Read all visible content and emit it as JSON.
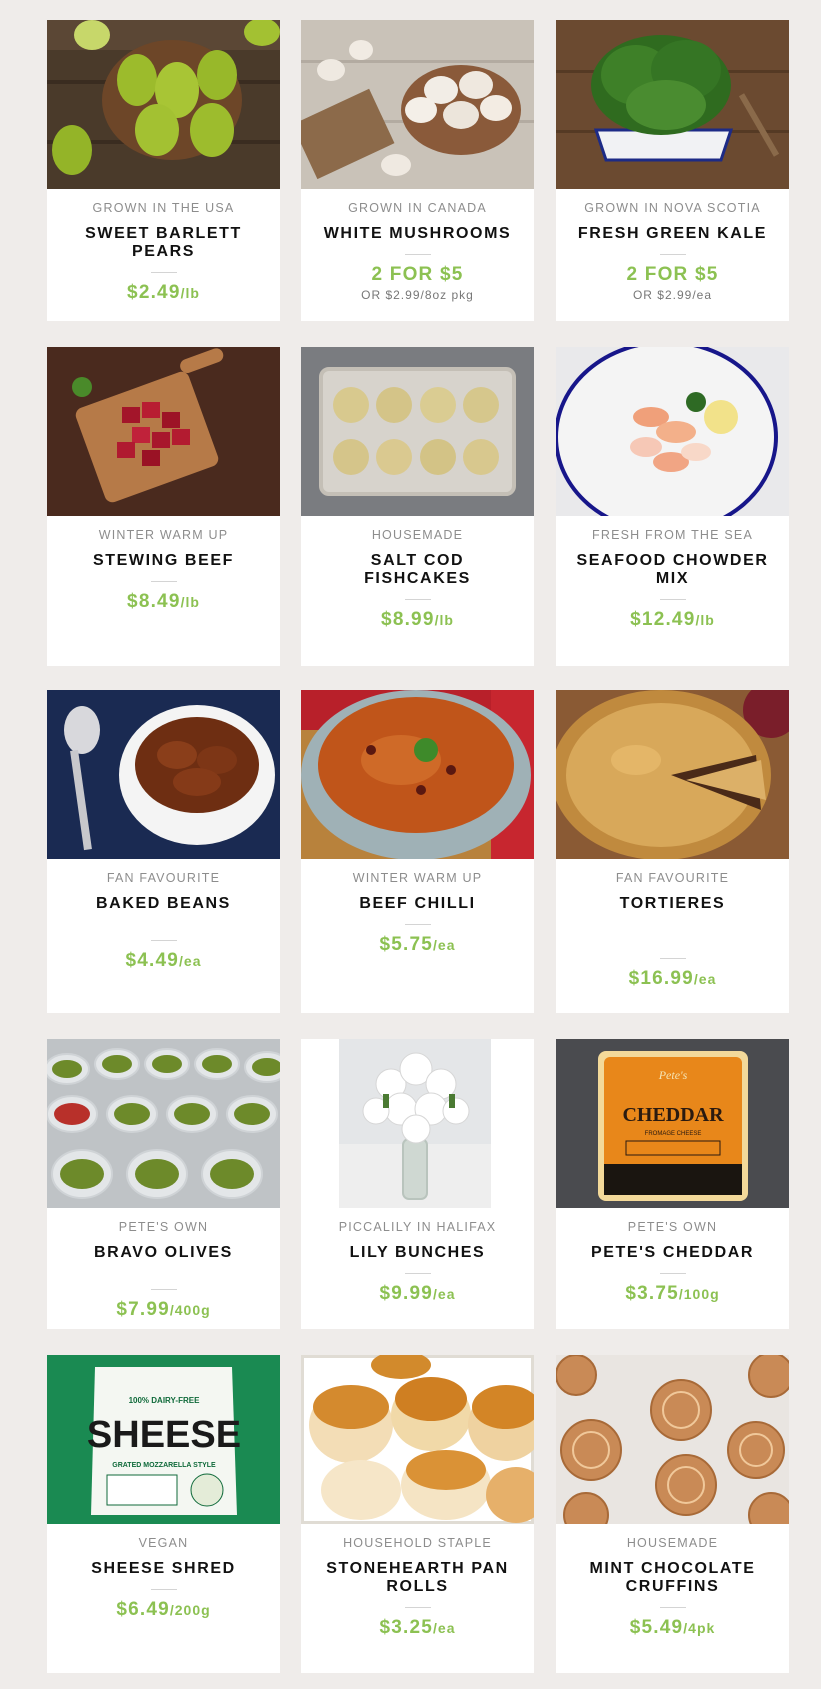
{
  "products": [
    {
      "origin": "GROWN IN THE USA",
      "name": "SWEET BARLETT PEARS",
      "price": "$2.49",
      "unit": "/lb",
      "alt": "",
      "image": "pears-photo"
    },
    {
      "origin": "GROWN IN CANADA",
      "name": "WHITE MUSHROOMS",
      "price": "2 FOR $5",
      "unit": "",
      "alt": "OR $2.99/8oz pkg",
      "image": "mushrooms-photo"
    },
    {
      "origin": "GROWN IN NOVA SCOTIA",
      "name": "FRESH GREEN KALE",
      "price": "2 FOR $5",
      "unit": "",
      "alt": "OR $2.99/ea",
      "image": "kale-photo"
    },
    {
      "origin": "WINTER WARM UP",
      "name": "STEWING BEEF",
      "price": "$8.49",
      "unit": "/lb",
      "alt": "",
      "image": "beef-photo"
    },
    {
      "origin": "HOUSEMADE",
      "name": "SALT COD FISHCAKES",
      "price": "$8.99",
      "unit": "/lb",
      "alt": "",
      "image": "fishcakes-photo"
    },
    {
      "origin": "FRESH FROM THE SEA",
      "name": "SEAFOOD CHOWDER MIX",
      "price": "$12.49",
      "unit": "/lb",
      "alt": "",
      "image": "seafood-photo"
    },
    {
      "origin": "FAN FAVOURITE",
      "name": "BAKED BEANS",
      "price": "$4.49",
      "unit": "/ea",
      "alt": "",
      "image": "beans-photo"
    },
    {
      "origin": "WINTER WARM UP",
      "name": "BEEF CHILLI",
      "price": "$5.75",
      "unit": "/ea",
      "alt": "",
      "image": "chilli-photo"
    },
    {
      "origin": "FAN FAVOURITE",
      "name": "TORTIERES",
      "price": "$16.99",
      "unit": "/ea",
      "alt": "",
      "image": "tortiere-photo"
    },
    {
      "origin": "PETE'S OWN",
      "name": "BRAVO OLIVES",
      "price": "$7.99",
      "unit": "/400g",
      "alt": "",
      "image": "olives-photo"
    },
    {
      "origin": "PICCALILY IN HALIFAX",
      "name": "LILY BUNCHES",
      "price": "$9.99",
      "unit": "/ea",
      "alt": "",
      "image": "lilies-photo"
    },
    {
      "origin": "PETE'S OWN",
      "name": "PETE'S CHEDDAR",
      "price": "$3.75",
      "unit": "/100g",
      "alt": "",
      "image": "cheddar-photo",
      "label": {
        "brand": "Pete's",
        "title": "CHEDDAR",
        "sub": "FROMAGE CHEESE"
      }
    },
    {
      "origin": "VEGAN",
      "name": "SHEESE SHRED",
      "price": "$6.49",
      "unit": "/200g",
      "alt": "",
      "image": "sheese-photo",
      "label": {
        "top": "100% DAIRY-FREE",
        "title": "SHEESE",
        "sub": "GRATED MOZZARELLA STYLE"
      }
    },
    {
      "origin": "HOUSEHOLD STAPLE",
      "name": "STONEHEARTH PAN ROLLS",
      "price": "$3.25",
      "unit": "/ea",
      "alt": "",
      "image": "rolls-photo"
    },
    {
      "origin": "HOUSEMADE",
      "name": "MINT CHOCOLATE CRUFFINS",
      "price": "$5.49",
      "unit": "/4pk",
      "alt": "",
      "image": "cruffins-photo"
    }
  ],
  "colors": {
    "price": "#8cc152",
    "background": "#efecea"
  }
}
